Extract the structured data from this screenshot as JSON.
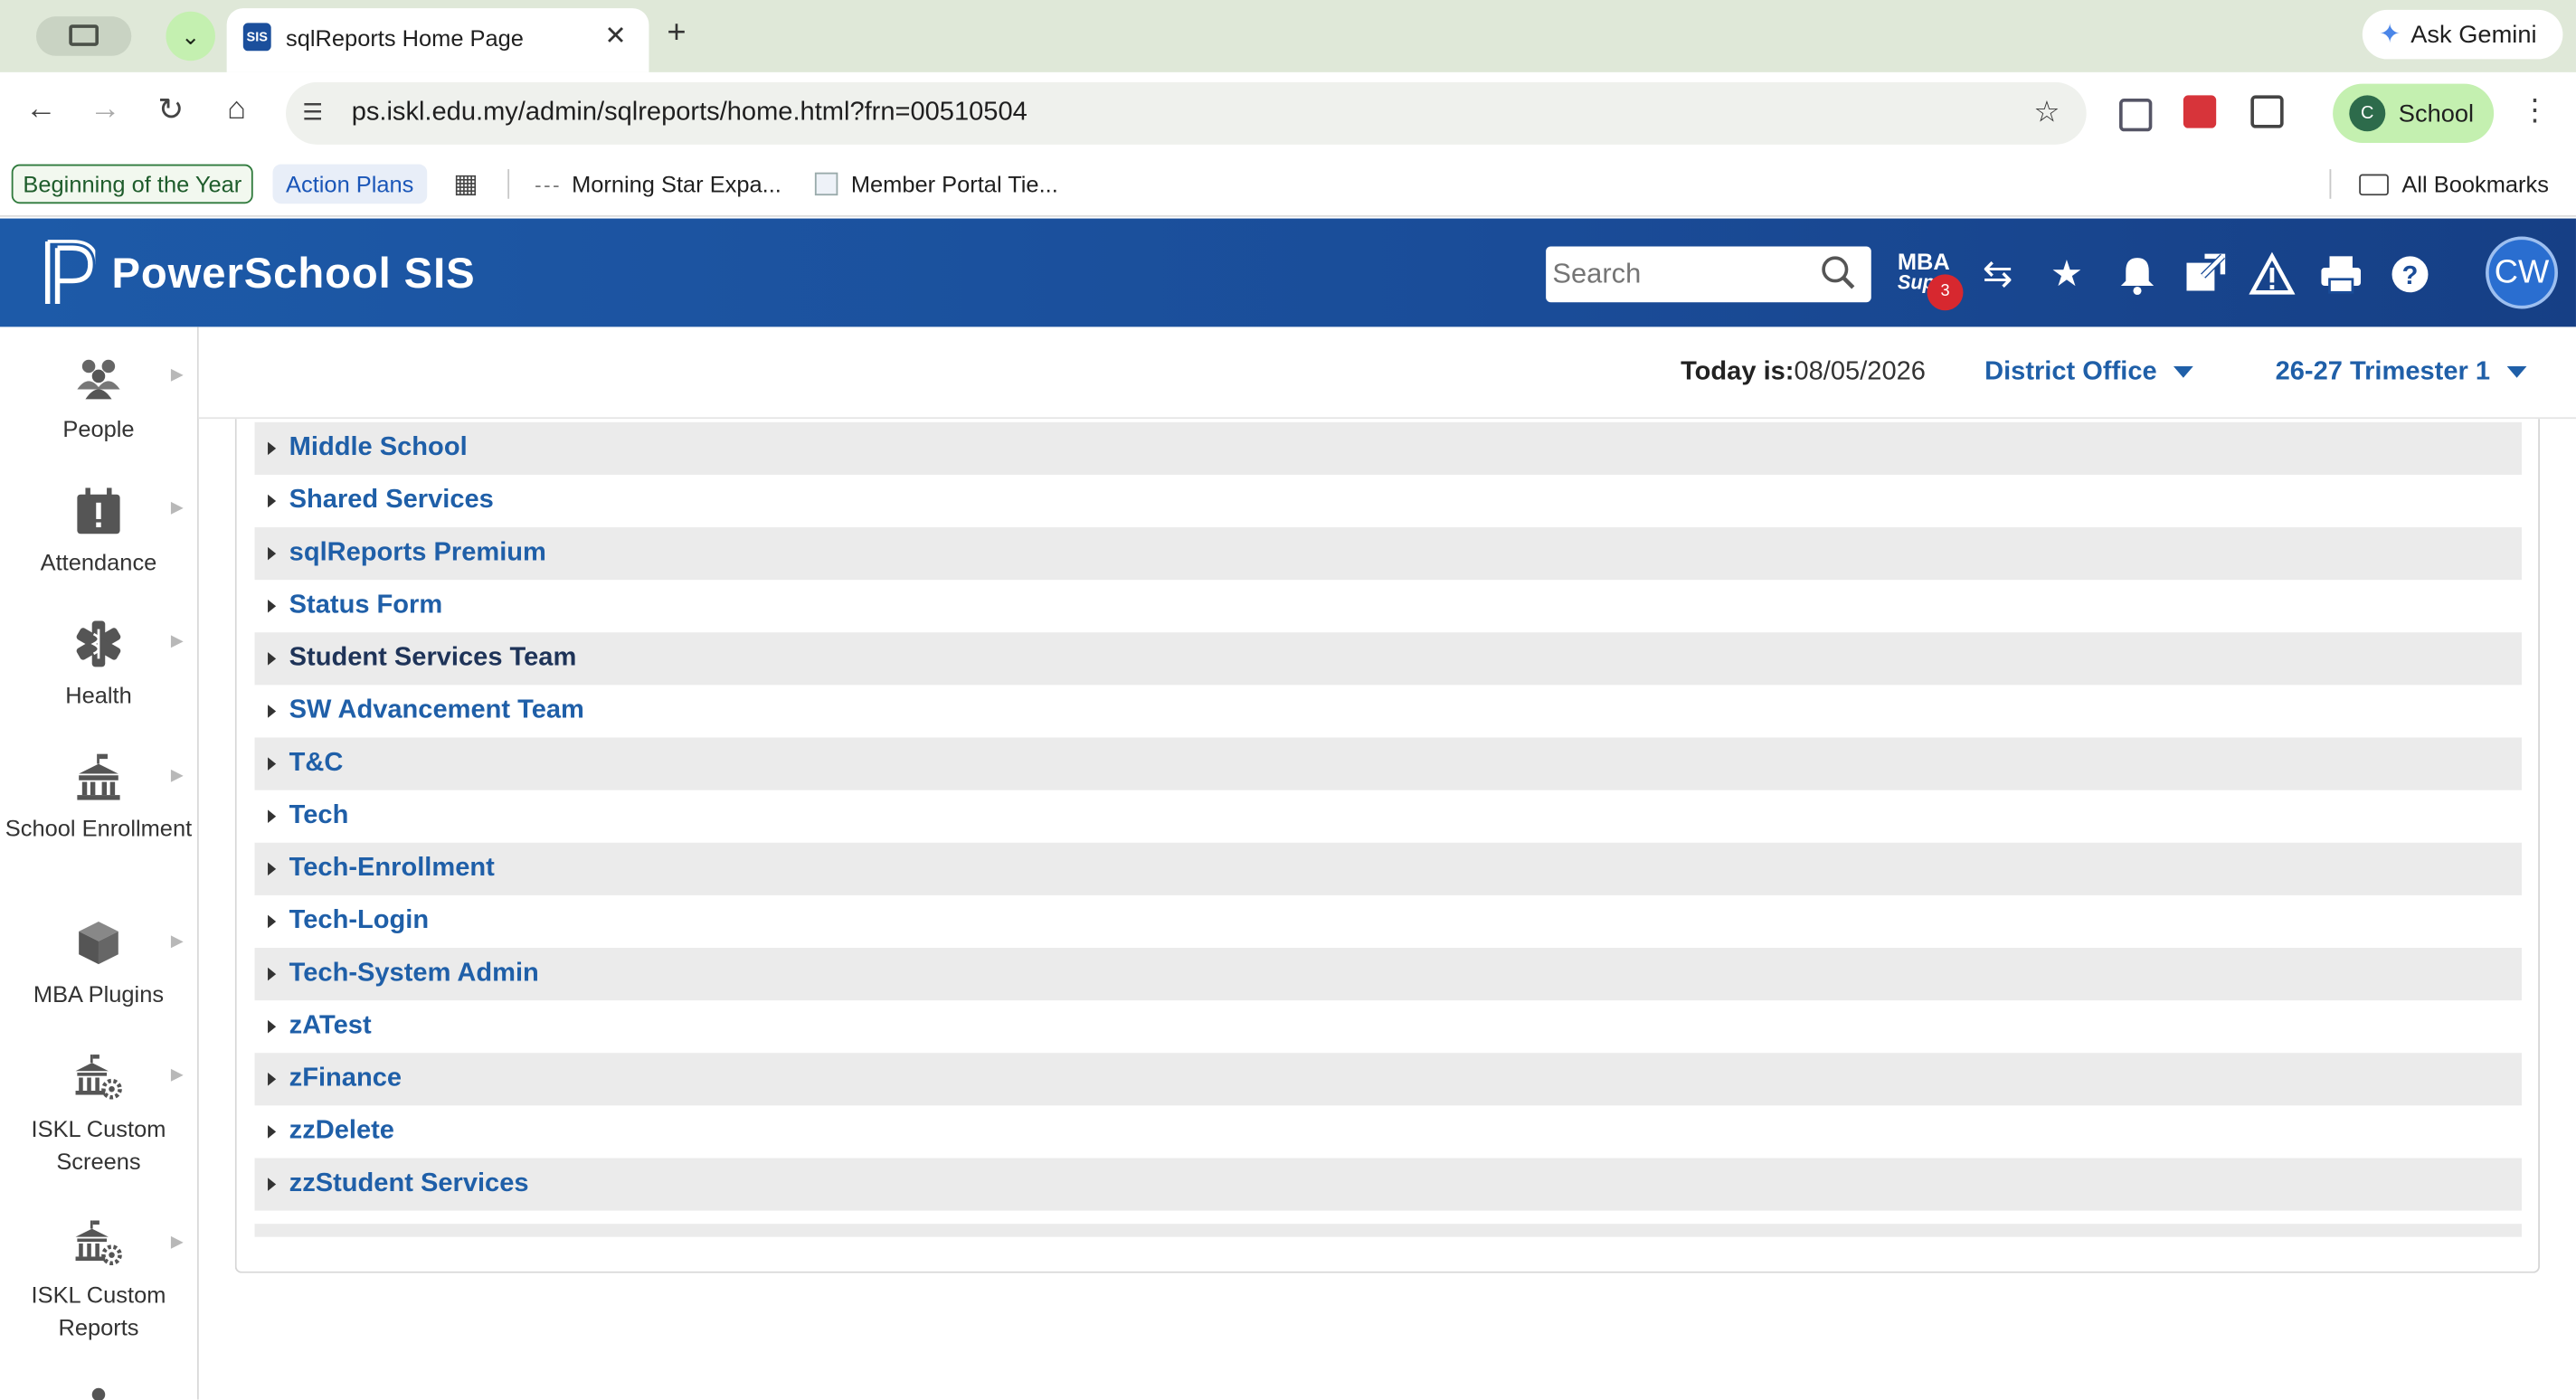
{
  "browser": {
    "tab_title": "sqlReports Home Page",
    "favicon_text": "SIS",
    "ask_gemini": "Ask Gemini",
    "url": "ps.iskl.edu.my/admin/sqlreports/home.html?frn=00510504",
    "profile_initial": "C",
    "profile_name": "School",
    "bookmarks": {
      "b1": "Beginning of the Year",
      "b2": "Action Plans",
      "b3": "Morning Star Expa...",
      "b4": "Member Portal Tie...",
      "all": "All Bookmarks"
    }
  },
  "header": {
    "title": "PowerSchool SIS",
    "search_placeholder": "Search",
    "mba_line1": "MBA",
    "mba_line2": "Supp",
    "mba_badge": "3",
    "user_initials": "CW"
  },
  "sidebar": {
    "items": [
      {
        "label": "People",
        "icon": "people-icon"
      },
      {
        "label": "Attendance",
        "icon": "attendance-icon"
      },
      {
        "label": "Health",
        "icon": "health-icon"
      },
      {
        "label": "School Enrollment",
        "icon": "school-icon"
      },
      {
        "label": "MBA Plugins",
        "icon": "plugins-icon"
      },
      {
        "label": "ISKL Custom Screens",
        "icon": "custom-screens-icon"
      },
      {
        "label": "ISKL Custom Reports",
        "icon": "custom-reports-icon"
      }
    ]
  },
  "infobar": {
    "today_label": "Today is:",
    "today_value": "08/05/2026",
    "school": "District Office",
    "term": "26-27 Trimester 1"
  },
  "groups": [
    "Middle School",
    "Shared Services",
    "sqlReports Premium",
    "Status Form",
    "Student Services Team",
    "SW Advancement Team",
    "T&C",
    "Tech",
    "Tech-Enrollment",
    "Tech-Login",
    "Tech-System Admin",
    "zATest",
    "zFinance",
    "zzDelete",
    "zzStudent Services"
  ]
}
